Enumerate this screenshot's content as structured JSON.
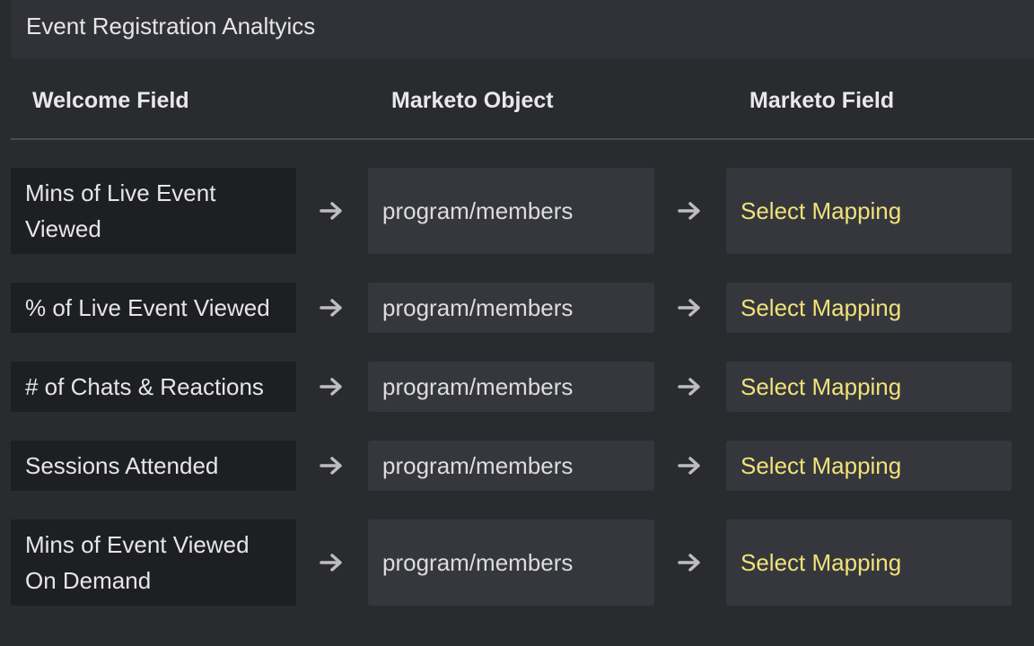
{
  "section": {
    "title": "Event Registration Analtyics"
  },
  "columns": {
    "welcome_field": "Welcome Field",
    "marketo_object": "Marketo Object",
    "marketo_field": "Marketo Field"
  },
  "rows": [
    {
      "welcome_field": "Mins of Live Event Viewed",
      "marketo_object": "program/members",
      "marketo_field": "Select Mapping"
    },
    {
      "welcome_field": "% of Live Event Viewed",
      "marketo_object": "program/members",
      "marketo_field": "Select Mapping"
    },
    {
      "welcome_field": "# of Chats & Reactions",
      "marketo_object": "program/members",
      "marketo_field": "Select Mapping"
    },
    {
      "welcome_field": "Sessions Attended",
      "marketo_object": "program/members",
      "marketo_field": "Select Mapping"
    },
    {
      "welcome_field": "Mins of Event Viewed On Demand",
      "marketo_object": "program/members",
      "marketo_field": "Select Mapping"
    }
  ],
  "icons": {
    "row_arrow": "arrow-right-icon"
  },
  "colors": {
    "mapping_placeholder": "#f0e27a",
    "background": "#2a2b2f",
    "welcome_cell": "#1e1f23",
    "value_cell": "#36373d"
  }
}
